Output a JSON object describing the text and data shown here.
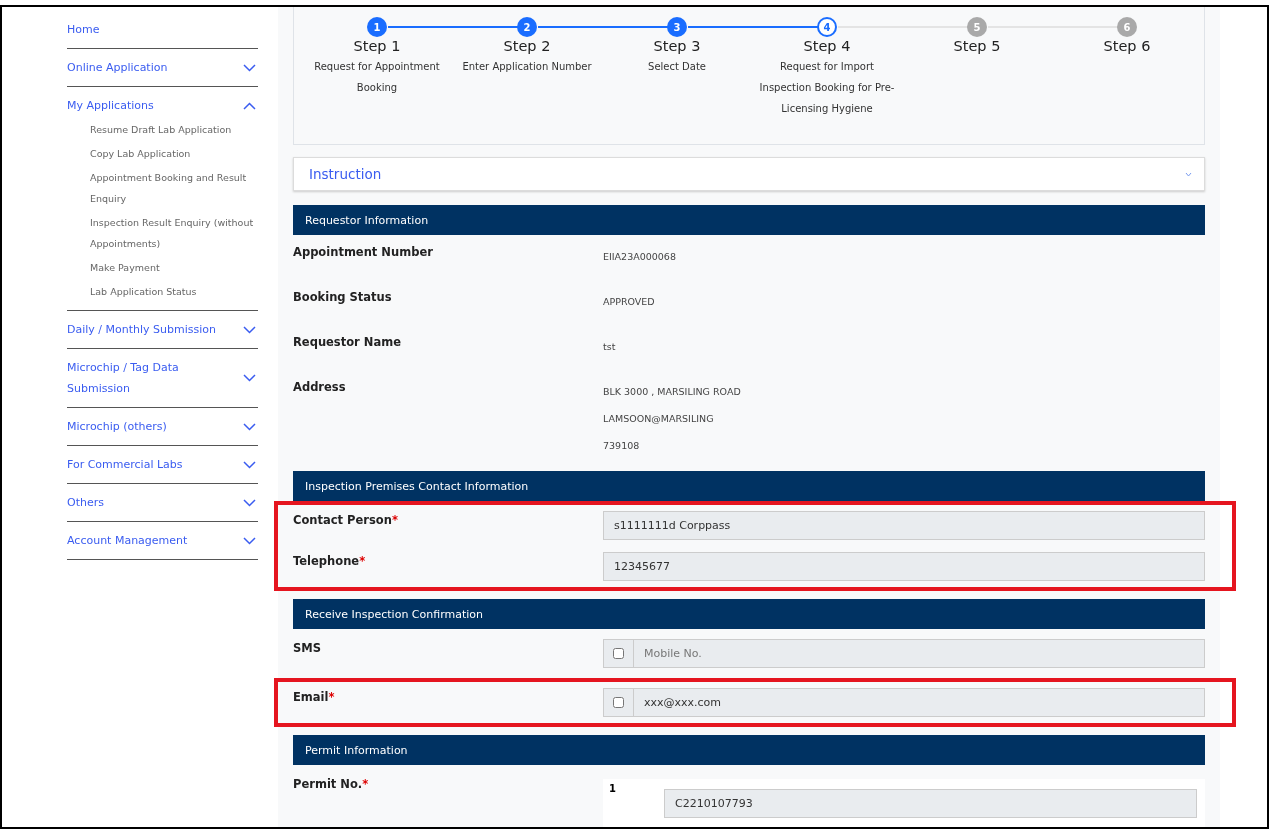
{
  "sidebar": {
    "items": [
      {
        "kind": "link",
        "label": "Home"
      },
      {
        "kind": "group",
        "label": "Online Application",
        "expanded": false
      },
      {
        "kind": "group",
        "label": "My Applications",
        "expanded": true,
        "children": [
          {
            "label": "Resume Draft Lab Application"
          },
          {
            "label": "Copy Lab Application"
          },
          {
            "label": "Appointment Booking and Result Enquiry"
          },
          {
            "label": "Inspection Result Enquiry (without Appointments)"
          },
          {
            "label": "Make Payment"
          },
          {
            "label": "Lab Application Status"
          }
        ]
      },
      {
        "kind": "group",
        "label": "Daily / Monthly Submission",
        "expanded": false
      },
      {
        "kind": "group",
        "label": "Microchip / Tag Data Submission",
        "expanded": false
      },
      {
        "kind": "group",
        "label": "Microchip (others)",
        "expanded": false
      },
      {
        "kind": "group",
        "label": "For Commercial Labs",
        "expanded": false
      },
      {
        "kind": "group",
        "label": "Others",
        "expanded": false
      },
      {
        "kind": "group",
        "label": "Account Management",
        "expanded": false
      }
    ]
  },
  "stepper": {
    "steps": [
      {
        "number": "1",
        "title": "Step 1",
        "description": "Request for Appointment Booking",
        "completed": true,
        "selected": false
      },
      {
        "number": "2",
        "title": "Step 2",
        "description": "Enter Application Number",
        "completed": true,
        "selected": false
      },
      {
        "number": "3",
        "title": "Step 3",
        "description": "Select Date",
        "completed": true,
        "selected": false
      },
      {
        "number": "4",
        "title": "Step 4",
        "description": "Request for Import Inspection Booking for Pre-Licensing Hygiene",
        "completed": false,
        "selected": true
      },
      {
        "number": "5",
        "title": "Step 5",
        "completed": false,
        "selected": false
      },
      {
        "number": "6",
        "title": "Step 6",
        "completed": false,
        "selected": false
      }
    ]
  },
  "instruction": {
    "title": "Instruction",
    "expanded": false
  },
  "sections": [
    {
      "title": "Requestor Information",
      "rows": [
        {
          "kind": "text",
          "label": "Appointment Number",
          "lines": [
            "EIIA23A000068"
          ]
        },
        {
          "kind": "text",
          "label": "Booking Status",
          "lines": [
            "APPROVED"
          ]
        },
        {
          "kind": "text",
          "label": "Requestor Name",
          "lines": [
            "tst"
          ]
        },
        {
          "kind": "text",
          "label": "Address",
          "lines": [
            "BLK 3000 , MARSILING ROAD",
            "LAMSOON@MARSILING",
            "739108"
          ]
        }
      ]
    },
    {
      "title": "Inspection Premises Contact Information",
      "rows": [
        {
          "kind": "input",
          "label": "Contact Person",
          "required_mark": "*",
          "value": "s1111111d Corppass",
          "highlighted": true
        },
        {
          "kind": "input",
          "label": "Telephone",
          "required_mark": "*",
          "value": "12345677",
          "highlighted": true
        }
      ]
    },
    {
      "title": "Receive Inspection Confirmation",
      "rows": [
        {
          "kind": "check-input",
          "label": "SMS",
          "checked": false,
          "placeholder": "Mobile No.",
          "highlighted": false
        },
        {
          "kind": "check-input",
          "label": "Email",
          "required_mark": "*",
          "checked": false,
          "value": "xxx@xxx.com",
          "highlighted": true
        }
      ]
    },
    {
      "title": "Permit Information",
      "rows": [
        {
          "kind": "list-input",
          "label": "Permit No.",
          "required_mark": "*",
          "index": "1",
          "value": "C2210107793",
          "highlighted": false
        }
      ]
    }
  ]
}
